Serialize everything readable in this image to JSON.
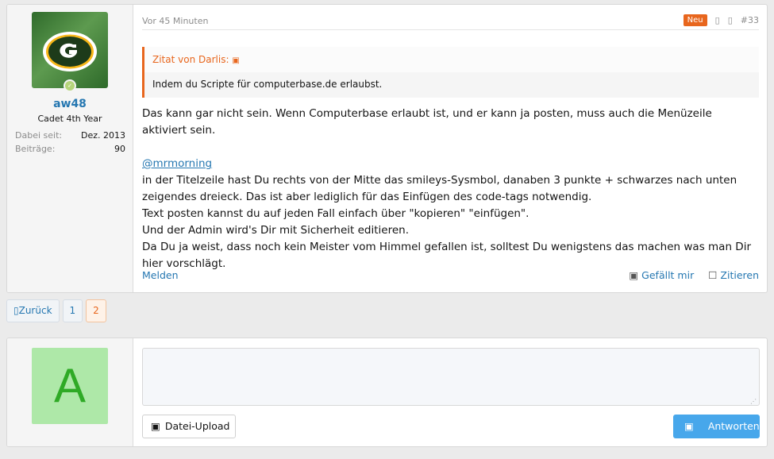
{
  "post": {
    "user": {
      "name": "aw48",
      "title": "Cadet 4th Year",
      "info": [
        {
          "label": "Dabei seit:",
          "value": "Dez. 2013"
        },
        {
          "label": "Beiträge:",
          "value": "90"
        }
      ]
    },
    "time": "Vor 45 Minuten",
    "badge": "Neu",
    "number": "#33",
    "quote": {
      "title": "Zitat von Darlis:",
      "text": "Indem du Scripte für computerbase.de erlaubst."
    },
    "body": {
      "p1": "Das kann gar nicht sein. Wenn Computerbase erlaubt ist, und er kann ja posten, muss auch die Menüzeile aktiviert sein.",
      "mention": "@mrmorning",
      "lines": [
        "in der Titelzeile hast Du rechts von der Mitte das smileys-Sysmbol, danaben 3 punkte + schwarzes nach unten zeigendes dreieck. Das ist aber lediglich für das Einfügen des code-tags notwendig.",
        "Text posten kannst du auf jeden Fall einfach über \"kopieren\" \"einfügen\".",
        "Und der Admin wird's Dir mit Sicherheit editieren.",
        "Da Du ja weist, dass noch kein Meister vom Himmel gefallen ist, solltest Du wenigstens das machen was man Dir hier vorschlägt."
      ]
    },
    "actions": {
      "report": "Melden",
      "like": "Gefällt mir",
      "quote": "Zitieren"
    }
  },
  "pagination": {
    "prev": "Zurück",
    "pages": [
      "1",
      "2"
    ],
    "current": "2"
  },
  "reply": {
    "avatar_letter": "A",
    "upload": "Datei-Upload",
    "submit": "Antworten"
  },
  "colors": {
    "accent": "#e8661d",
    "link": "#2577b1",
    "button": "#47a7eb"
  }
}
